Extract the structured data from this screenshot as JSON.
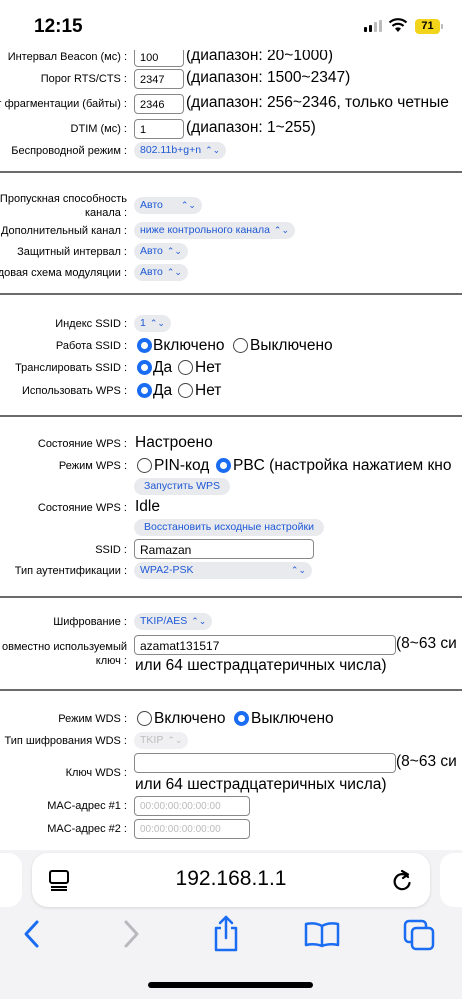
{
  "status_bar": {
    "time": "12:15",
    "battery": "71"
  },
  "wireless": {
    "beacon": {
      "label": "Интервал Beacon (мс) :",
      "value": "100",
      "hint": "(диапазон: 20~1000)"
    },
    "rts": {
      "label": "Порог RTS/CTS :",
      "value": "2347",
      "hint": "(диапазон: 1500~2347)"
    },
    "frag": {
      "label": "г фрагментации (байты) :",
      "value": "2346",
      "hint": "(диапазон: 256~2346, только четные"
    },
    "dtim": {
      "label": "DTIM (мс) :",
      "value": "1",
      "hint": "(диапазон: 1~255)"
    },
    "mode": {
      "label": "Беспроводной режим :",
      "value": "802.11b+g+n"
    }
  },
  "channel": {
    "bandwidth": {
      "label": "Пропускная способность канала :",
      "value": "Авто"
    },
    "ext_channel": {
      "label": "Дополнительный канал :",
      "value": "ниже контрольного канала"
    },
    "guard": {
      "label": "Защитный интервал :",
      "value": "Авто"
    },
    "mcs": {
      "label": "довая схема модуляции :",
      "value": "Авто"
    }
  },
  "ssid": {
    "index": {
      "label": "Индекс SSID :",
      "value": "1"
    },
    "work": {
      "label": "Работа SSID :",
      "on": "Включено",
      "off": "Выключено",
      "selected": "on"
    },
    "broadcast": {
      "label": "Транслировать SSID :",
      "yes": "Да",
      "no": "Нет",
      "selected": "yes"
    },
    "use_wps": {
      "label": "Использовать WPS :",
      "yes": "Да",
      "no": "Нет",
      "selected": "yes"
    }
  },
  "wps": {
    "state": {
      "label": "Состояние WPS :",
      "value": "Настроено"
    },
    "mode": {
      "label": "Режим WPS :",
      "pin": "PIN-код",
      "pbc": "PBC (настройка нажатием кно",
      "selected": "pbc"
    },
    "start_button": "Запустить WPS",
    "state2": {
      "label": "Состояние WPS :",
      "value": "Idle"
    },
    "reset_button": "Восстановить исходные настройки",
    "ssid": {
      "label": "SSID :",
      "value": "Ramazan"
    },
    "auth": {
      "label": "Тип аутентификации :",
      "value": "WPA2-PSK"
    }
  },
  "encryption": {
    "cipher": {
      "label": "Шифрование :",
      "value": "TKIP/AES"
    },
    "psk": {
      "label": "овместно используемый ключ :",
      "value": "azamat131517",
      "hint1": "(8~63 си",
      "hint2": "или 64 шестрадцатеричных числа)"
    }
  },
  "wds": {
    "mode": {
      "label": "Режим WDS :",
      "on": "Включено",
      "off": "Выключено",
      "selected": "off"
    },
    "cipher": {
      "label": "Тип шифрования WDS :",
      "value": "TKIP"
    },
    "key": {
      "label": "Ключ WDS :",
      "value": "",
      "hint1": "(8~63 си",
      "hint2": "или 64 шестрадцатеричных числа)"
    },
    "mac1": {
      "label": "MAC-адрес #1 :",
      "placeholder": "00:00:00:00:00:00"
    },
    "mac2": {
      "label": "MAC-адрес #2 :",
      "placeholder": "00:00:00:00:00:00"
    }
  },
  "browser": {
    "url": "192.168.1.1"
  },
  "colors": {
    "accent": "#1a6cf2",
    "link": "#1d58d6",
    "battery": "#f2d41a"
  },
  "icons": [
    "signal-icon",
    "wifi-icon",
    "reader-mode-icon",
    "reload-icon",
    "back-icon",
    "forward-icon",
    "share-icon",
    "bookmarks-icon",
    "tabs-icon"
  ]
}
